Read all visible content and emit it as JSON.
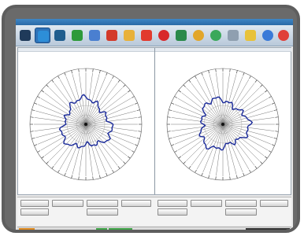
{
  "app": {
    "title": ""
  },
  "toolbar": {
    "buttons": [
      {
        "name": "home-button",
        "icon": "home-icon",
        "color": "#1f3a5a"
      },
      {
        "name": "report-button",
        "icon": "report-icon",
        "color": "#2d8ed8",
        "selected": true
      },
      {
        "name": "instrument-button",
        "icon": "instrument-icon",
        "color": "#1f5d8e"
      },
      {
        "name": "tools-button",
        "icon": "tools-icon",
        "color": "#2e9a3a"
      },
      {
        "name": "bookmark-button",
        "icon": "bookmark-icon",
        "color": "#d33a2a"
      },
      {
        "name": "grid-button",
        "icon": "grid-icon",
        "color": "#4a7fd0"
      },
      {
        "name": "chart-button",
        "icon": "bar-chart-icon",
        "color": "#e23a2e"
      },
      {
        "name": "folder-button",
        "icon": "folder-icon",
        "color": "#e8b13a"
      },
      {
        "name": "stop-button",
        "icon": "stop-icon",
        "color": "#d8282b"
      },
      {
        "name": "camera-button",
        "icon": "camera-icon",
        "color": "#2a8a4a"
      },
      {
        "name": "target-button",
        "icon": "target-icon",
        "color": "#e2a62a"
      },
      {
        "name": "refresh-button",
        "icon": "refresh-icon",
        "color": "#3aa85a"
      },
      {
        "name": "print-button",
        "icon": "print-icon",
        "color": "#8f9fb0"
      },
      {
        "name": "star-button",
        "icon": "star-icon",
        "color": "#e8c23a"
      },
      {
        "name": "globe-button",
        "icon": "globe-icon",
        "color": "#3a7ad8"
      },
      {
        "name": "close-button",
        "icon": "close-icon",
        "color": "#e0403a"
      }
    ]
  },
  "panes": {
    "left": {
      "label": ""
    },
    "right": {
      "label": ""
    }
  },
  "bottom_panel": {
    "row1": [
      "",
      "",
      "",
      ""
    ],
    "row2": [
      "",
      ""
    ]
  },
  "statusbar": {
    "segments": [
      "",
      "",
      "",
      "",
      "",
      ""
    ]
  },
  "colors": {
    "trace": "#1a2a9a",
    "spoke": "#777777",
    "accent": "#2f73b8"
  }
}
